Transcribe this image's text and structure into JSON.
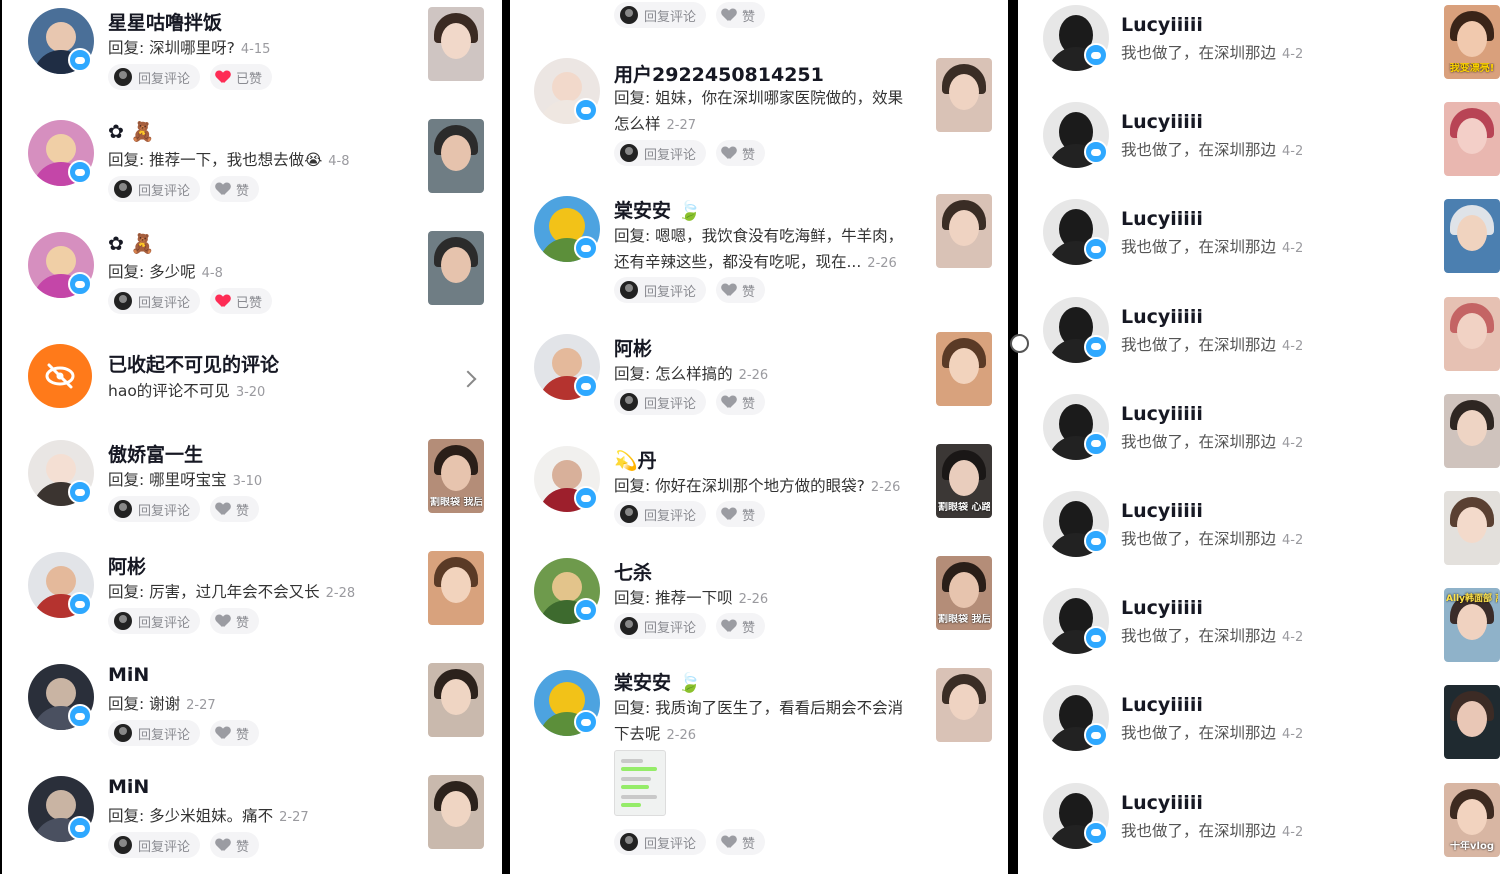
{
  "actions": {
    "reply": "回复评论",
    "like": "赞",
    "liked": "已赞"
  },
  "panel1": {
    "comments": [
      {
        "name": "星星咕噜拌饭",
        "text": "回复: 深圳哪里呀?",
        "date": "4-15",
        "liked": true
      },
      {
        "name": "✿ 🧸",
        "text": "回复: 推荐一下，我也想去做😭",
        "date": "4-8",
        "liked": false
      },
      {
        "name": "✿ 🧸",
        "text": "回复: 多少呢",
        "date": "4-8",
        "liked": true
      },
      {
        "name": "傲娇富一生",
        "text": "回复: 哪里呀宝宝",
        "date": "3-10",
        "liked": false
      },
      {
        "name": "阿彬",
        "text": "回复: 厉害，过几年会不会又长",
        "date": "2-28",
        "liked": false
      },
      {
        "name": "MiN",
        "text": "回复: 谢谢",
        "date": "2-27",
        "liked": false
      },
      {
        "name": "MiN",
        "text": "回复: 多少米姐妹。痛不",
        "date": "2-27",
        "liked": false
      }
    ],
    "hidden": {
      "title": "已收起不可见的评论",
      "text": "hao的评论不可见",
      "date": "3-20"
    },
    "thumb_caption": "割眼袋 我后悔了!"
  },
  "panel2": {
    "comments": [
      {
        "name": "用户2922450814251",
        "line1": "回复: 姐妹，你在深圳哪家医院做的，效果",
        "line2": "怎么样",
        "date": "2-27"
      },
      {
        "name": "棠安安 🍃",
        "line1": "回复: 嗯嗯，我饮食没有吃海鲜，牛羊肉，",
        "line2": "还有辛辣这些，都没有吃呢，现在...",
        "date": "2-26"
      },
      {
        "name": "阿彬",
        "line1": "回复: 怎么样搞的",
        "line2": "",
        "date": "2-26"
      },
      {
        "name": "💫丹",
        "line1": "回复: 你好在深圳那个地方做的眼袋?",
        "line2": "",
        "date": "2-26"
      },
      {
        "name": "七杀",
        "line1": "回复: 推荐一下呗",
        "line2": "",
        "date": "2-26"
      },
      {
        "name": "棠安安 🍃",
        "line1": "回复: 我质询了医生了，看看后期会不会消",
        "line2": "下去呢",
        "date": "2-26"
      }
    ],
    "thumb_caption1": "割眼袋 心路历程",
    "thumb_caption2": "割眼袋 我后悔了!"
  },
  "panel3": {
    "name": "Lucyiiiii",
    "text": "我也做了，在深圳那边",
    "date": "4-2",
    "thumb_caption_first": "我变漂亮!",
    "thumb_caption_ally": "Ally韩面部 离谱提升",
    "thumb_caption_last": "十年vlog"
  }
}
